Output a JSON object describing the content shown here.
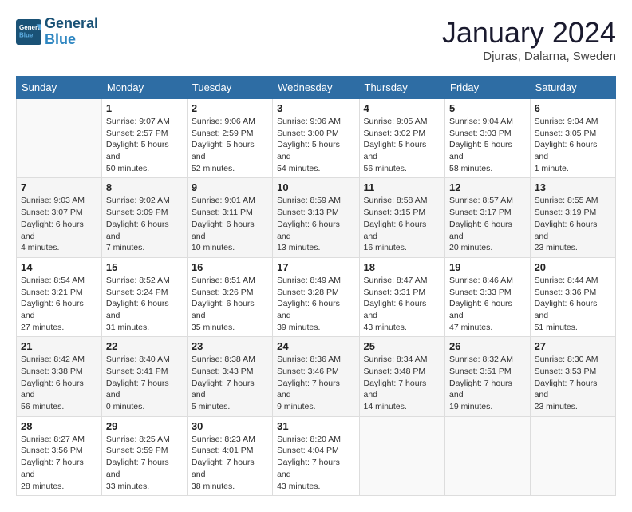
{
  "logo": {
    "text_general": "General",
    "text_blue": "Blue"
  },
  "title": "January 2024",
  "location": "Djuras, Dalarna, Sweden",
  "weekdays": [
    "Sunday",
    "Monday",
    "Tuesday",
    "Wednesday",
    "Thursday",
    "Friday",
    "Saturday"
  ],
  "weeks": [
    [
      {
        "day": null
      },
      {
        "day": 1,
        "sunrise": "9:07 AM",
        "sunset": "2:57 PM",
        "daylight": "5 hours and 50 minutes."
      },
      {
        "day": 2,
        "sunrise": "9:06 AM",
        "sunset": "2:59 PM",
        "daylight": "5 hours and 52 minutes."
      },
      {
        "day": 3,
        "sunrise": "9:06 AM",
        "sunset": "3:00 PM",
        "daylight": "5 hours and 54 minutes."
      },
      {
        "day": 4,
        "sunrise": "9:05 AM",
        "sunset": "3:02 PM",
        "daylight": "5 hours and 56 minutes."
      },
      {
        "day": 5,
        "sunrise": "9:04 AM",
        "sunset": "3:03 PM",
        "daylight": "5 hours and 58 minutes."
      },
      {
        "day": 6,
        "sunrise": "9:04 AM",
        "sunset": "3:05 PM",
        "daylight": "6 hours and 1 minute."
      }
    ],
    [
      {
        "day": 7,
        "sunrise": "9:03 AM",
        "sunset": "3:07 PM",
        "daylight": "6 hours and 4 minutes."
      },
      {
        "day": 8,
        "sunrise": "9:02 AM",
        "sunset": "3:09 PM",
        "daylight": "6 hours and 7 minutes."
      },
      {
        "day": 9,
        "sunrise": "9:01 AM",
        "sunset": "3:11 PM",
        "daylight": "6 hours and 10 minutes."
      },
      {
        "day": 10,
        "sunrise": "8:59 AM",
        "sunset": "3:13 PM",
        "daylight": "6 hours and 13 minutes."
      },
      {
        "day": 11,
        "sunrise": "8:58 AM",
        "sunset": "3:15 PM",
        "daylight": "6 hours and 16 minutes."
      },
      {
        "day": 12,
        "sunrise": "8:57 AM",
        "sunset": "3:17 PM",
        "daylight": "6 hours and 20 minutes."
      },
      {
        "day": 13,
        "sunrise": "8:55 AM",
        "sunset": "3:19 PM",
        "daylight": "6 hours and 23 minutes."
      }
    ],
    [
      {
        "day": 14,
        "sunrise": "8:54 AM",
        "sunset": "3:21 PM",
        "daylight": "6 hours and 27 minutes."
      },
      {
        "day": 15,
        "sunrise": "8:52 AM",
        "sunset": "3:24 PM",
        "daylight": "6 hours and 31 minutes."
      },
      {
        "day": 16,
        "sunrise": "8:51 AM",
        "sunset": "3:26 PM",
        "daylight": "6 hours and 35 minutes."
      },
      {
        "day": 17,
        "sunrise": "8:49 AM",
        "sunset": "3:28 PM",
        "daylight": "6 hours and 39 minutes."
      },
      {
        "day": 18,
        "sunrise": "8:47 AM",
        "sunset": "3:31 PM",
        "daylight": "6 hours and 43 minutes."
      },
      {
        "day": 19,
        "sunrise": "8:46 AM",
        "sunset": "3:33 PM",
        "daylight": "6 hours and 47 minutes."
      },
      {
        "day": 20,
        "sunrise": "8:44 AM",
        "sunset": "3:36 PM",
        "daylight": "6 hours and 51 minutes."
      }
    ],
    [
      {
        "day": 21,
        "sunrise": "8:42 AM",
        "sunset": "3:38 PM",
        "daylight": "6 hours and 56 minutes."
      },
      {
        "day": 22,
        "sunrise": "8:40 AM",
        "sunset": "3:41 PM",
        "daylight": "7 hours and 0 minutes."
      },
      {
        "day": 23,
        "sunrise": "8:38 AM",
        "sunset": "3:43 PM",
        "daylight": "7 hours and 5 minutes."
      },
      {
        "day": 24,
        "sunrise": "8:36 AM",
        "sunset": "3:46 PM",
        "daylight": "7 hours and 9 minutes."
      },
      {
        "day": 25,
        "sunrise": "8:34 AM",
        "sunset": "3:48 PM",
        "daylight": "7 hours and 14 minutes."
      },
      {
        "day": 26,
        "sunrise": "8:32 AM",
        "sunset": "3:51 PM",
        "daylight": "7 hours and 19 minutes."
      },
      {
        "day": 27,
        "sunrise": "8:30 AM",
        "sunset": "3:53 PM",
        "daylight": "7 hours and 23 minutes."
      }
    ],
    [
      {
        "day": 28,
        "sunrise": "8:27 AM",
        "sunset": "3:56 PM",
        "daylight": "7 hours and 28 minutes."
      },
      {
        "day": 29,
        "sunrise": "8:25 AM",
        "sunset": "3:59 PM",
        "daylight": "7 hours and 33 minutes."
      },
      {
        "day": 30,
        "sunrise": "8:23 AM",
        "sunset": "4:01 PM",
        "daylight": "7 hours and 38 minutes."
      },
      {
        "day": 31,
        "sunrise": "8:20 AM",
        "sunset": "4:04 PM",
        "daylight": "7 hours and 43 minutes."
      },
      {
        "day": null
      },
      {
        "day": null
      },
      {
        "day": null
      }
    ]
  ],
  "labels": {
    "sunrise": "Sunrise:",
    "sunset": "Sunset:",
    "daylight": "Daylight:"
  }
}
